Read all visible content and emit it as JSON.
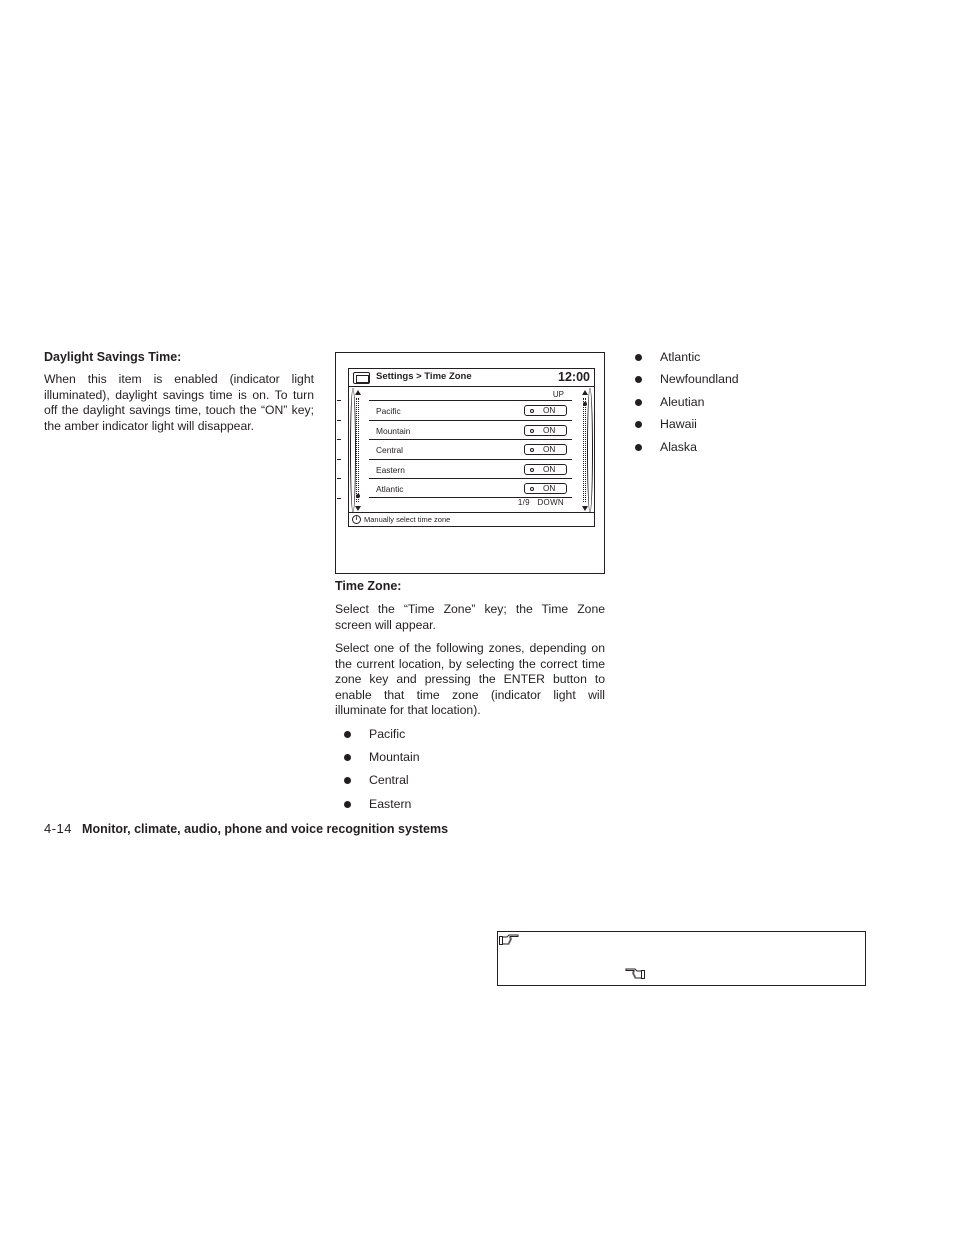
{
  "left_column": {
    "heading": "Daylight Savings Time:",
    "paragraph": "When this item is enabled (indicator light illuminated), daylight savings time is on. To turn off the daylight savings time, touch the “ON” key; the amber indicator light will disappear."
  },
  "figure": {
    "screen_title": "Settings > Time Zone",
    "clock": "12:00",
    "up_label": "UP",
    "down_label": "DOWN",
    "page_indicator": "1/9",
    "rows": [
      {
        "label": "Pacific",
        "toggle": "ON"
      },
      {
        "label": "Mountain",
        "toggle": "ON"
      },
      {
        "label": "Central",
        "toggle": "ON"
      },
      {
        "label": "Eastern",
        "toggle": "ON"
      },
      {
        "label": "Atlantic",
        "toggle": "ON"
      }
    ],
    "info_icon": "i",
    "footer_text": "Manually select time zone"
  },
  "middle_column": {
    "heading": "Time Zone:",
    "paragraph1": "Select the “Time Zone” key; the Time Zone screen will appear.",
    "paragraph2": "Select one of the following zones, depending on the current location, by selecting the correct time zone key and pressing the ENTER button to enable that time zone (indicator light will illuminate for that location).",
    "bullets": [
      "Pacific",
      "Mountain",
      "Central",
      "Eastern"
    ]
  },
  "right_column": {
    "bullets": [
      "Atlantic",
      "Newfoundland",
      "Aleutian",
      "Hawaii",
      "Alaska"
    ]
  },
  "page_footer": {
    "page_number": "4-14",
    "section_title": "Monitor, climate, audio, phone and voice recognition systems"
  },
  "note_box": {
    "icons": [
      "pointing-hand-right-icon",
      "pointing-hand-left-icon"
    ]
  }
}
